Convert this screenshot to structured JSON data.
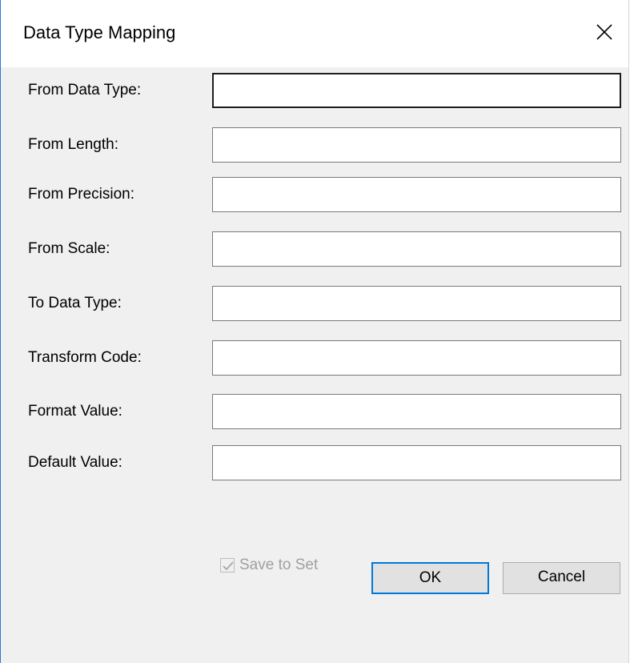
{
  "dialog": {
    "title": "Data Type Mapping",
    "close_icon": "close-icon"
  },
  "fields": [
    {
      "label": "From Data Type:",
      "value": ""
    },
    {
      "label": "From Length:",
      "value": ""
    },
    {
      "label": "From Precision:",
      "value": ""
    },
    {
      "label": "From Scale:",
      "value": ""
    },
    {
      "label": "To Data Type:",
      "value": ""
    },
    {
      "label": "Transform Code:",
      "value": ""
    },
    {
      "label": "Format Value:",
      "value": ""
    },
    {
      "label": "Default Value:",
      "value": ""
    }
  ],
  "save_to_set": {
    "label": "Save to Set",
    "checked": true,
    "enabled": false
  },
  "buttons": {
    "ok": "OK",
    "cancel": "Cancel"
  },
  "colors": {
    "accent": "#0078d7",
    "window_border": "#2b79d6",
    "dialog_bg": "#f0f0f0"
  }
}
